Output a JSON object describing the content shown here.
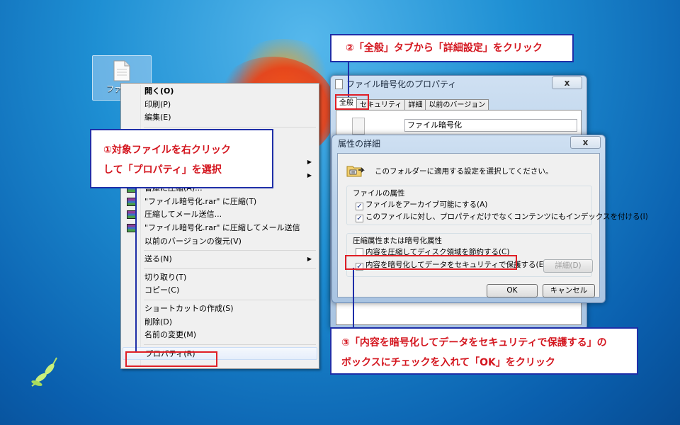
{
  "desktop": {
    "file_icon_label": "ファイル"
  },
  "context_menu": {
    "items": [
      {
        "label": "開く(O)",
        "bold": true
      },
      {
        "label": "印刷(P)"
      },
      {
        "label": "編集(E)"
      },
      {
        "label": "書庫に圧縮(A)...",
        "rar": true
      },
      {
        "label": "\"ファイル暗号化.rar\" に圧縮(T)",
        "rar": true
      },
      {
        "label": "圧縮してメール送信...",
        "rar": true
      },
      {
        "label": "\"ファイル暗号化.rar\" に圧縮してメール送信",
        "rar": true
      },
      {
        "label": "以前のバージョンの復元(V)"
      },
      {
        "label": "送る(N)"
      },
      {
        "label": "切り取り(T)"
      },
      {
        "label": "コピー(C)"
      },
      {
        "label": "ショートカットの作成(S)"
      },
      {
        "label": "削除(D)"
      },
      {
        "label": "名前の変更(M)"
      },
      {
        "label": "プロパティ(R)"
      }
    ]
  },
  "callouts": {
    "step1_line1": "①対象ファイルを右クリック",
    "step1_line2": "して「プロパティ」を選択",
    "step2": "②「全般」タブから「詳細設定」をクリック",
    "step3_line1": "③「内容を暗号化してデータをセキュリティで保護する」の",
    "step3_line2": "ボックスにチェックを入れて「OK」をクリック"
  },
  "properties_dialog": {
    "title": "ファイル暗号化のプロパティ",
    "close": "x",
    "tabs": [
      "全般",
      "セキュリティ",
      "詳細",
      "以前のバージョン"
    ],
    "file_name": "ファイル暗号化"
  },
  "advanced_dialog": {
    "title": "属性の詳細",
    "close": "x",
    "description": "このフォルダーに適用する設定を選択してください。",
    "file_attributes_title": "ファイルの属性",
    "archive_label": "ファイルをアーカイブ可能にする(A)",
    "index_label": "このファイルに対し、プロパティだけでなくコンテンツにもインデックスを付ける(I)",
    "compress_encrypt_title": "圧縮属性または暗号化属性",
    "compress_label": "内容を圧縮してディスク領域を節約する(C)",
    "encrypt_label": "内容を暗号化してデータをセキュリティで保護する(E)",
    "details_button": "詳細(D)",
    "ok_button": "OK",
    "cancel_button": "キャンセル",
    "check_mark": "✓"
  }
}
